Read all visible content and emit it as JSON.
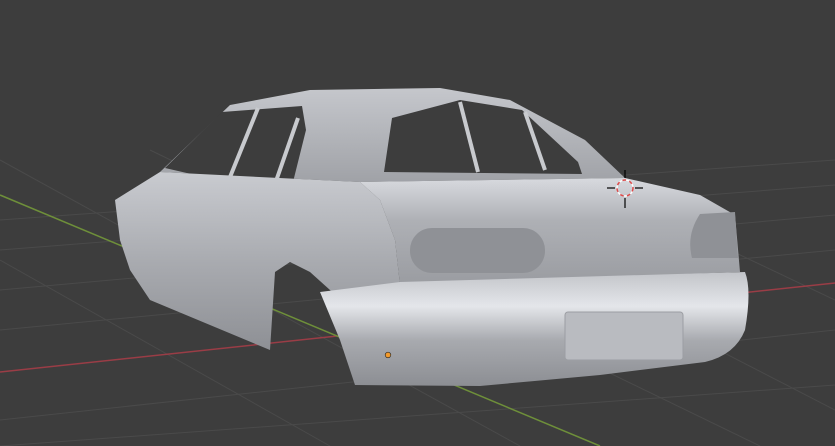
{
  "viewport": {
    "kind": "3d-viewport",
    "background_color": "#3d3d3d",
    "grid_color": "#4a4a4a",
    "x_axis_color": "#9a3d46",
    "y_axis_color": "#6e8f3a"
  },
  "scene": {
    "object": "car-body-mesh",
    "object_color": "#b4b6bb",
    "origin_color": "#f29a2c",
    "icons": [
      "3d-cursor-icon",
      "object-origin-icon"
    ]
  }
}
